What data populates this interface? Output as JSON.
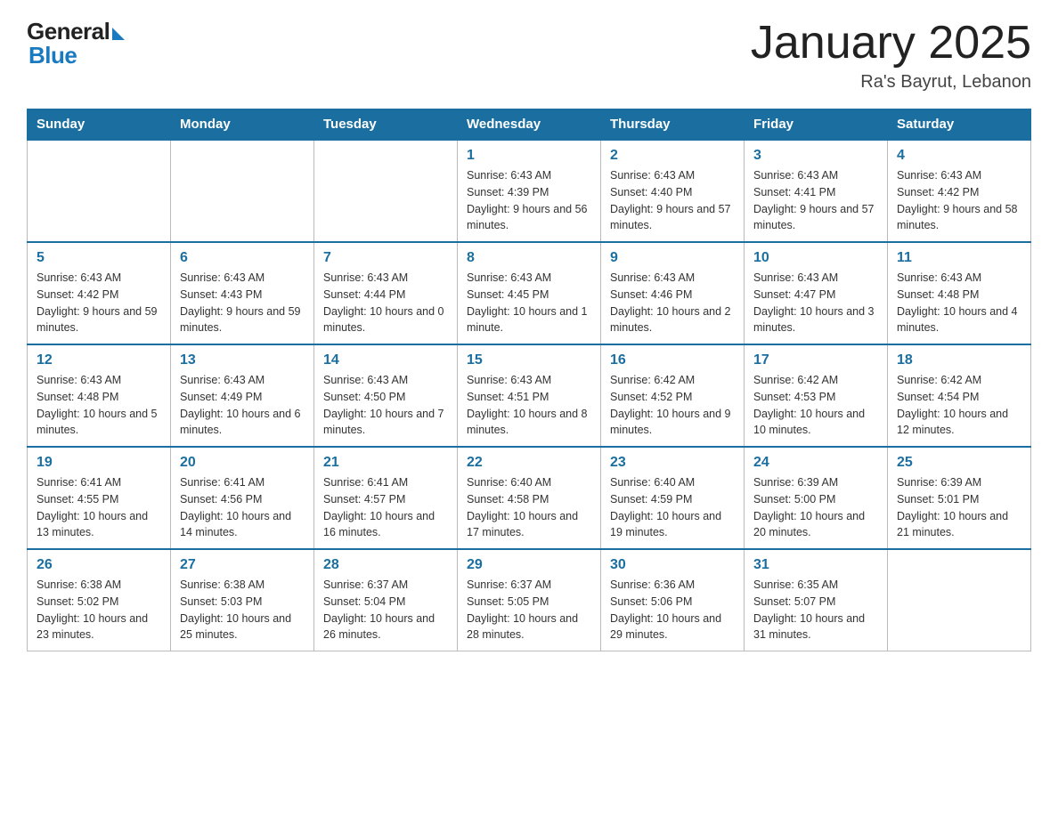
{
  "header": {
    "logo_general": "General",
    "logo_blue": "Blue",
    "month_title": "January 2025",
    "location": "Ra's Bayrut, Lebanon"
  },
  "weekdays": [
    "Sunday",
    "Monday",
    "Tuesday",
    "Wednesday",
    "Thursday",
    "Friday",
    "Saturday"
  ],
  "weeks": [
    [
      {
        "day": "",
        "info": ""
      },
      {
        "day": "",
        "info": ""
      },
      {
        "day": "",
        "info": ""
      },
      {
        "day": "1",
        "info": "Sunrise: 6:43 AM\nSunset: 4:39 PM\nDaylight: 9 hours and 56 minutes."
      },
      {
        "day": "2",
        "info": "Sunrise: 6:43 AM\nSunset: 4:40 PM\nDaylight: 9 hours and 57 minutes."
      },
      {
        "day": "3",
        "info": "Sunrise: 6:43 AM\nSunset: 4:41 PM\nDaylight: 9 hours and 57 minutes."
      },
      {
        "day": "4",
        "info": "Sunrise: 6:43 AM\nSunset: 4:42 PM\nDaylight: 9 hours and 58 minutes."
      }
    ],
    [
      {
        "day": "5",
        "info": "Sunrise: 6:43 AM\nSunset: 4:42 PM\nDaylight: 9 hours and 59 minutes."
      },
      {
        "day": "6",
        "info": "Sunrise: 6:43 AM\nSunset: 4:43 PM\nDaylight: 9 hours and 59 minutes."
      },
      {
        "day": "7",
        "info": "Sunrise: 6:43 AM\nSunset: 4:44 PM\nDaylight: 10 hours and 0 minutes."
      },
      {
        "day": "8",
        "info": "Sunrise: 6:43 AM\nSunset: 4:45 PM\nDaylight: 10 hours and 1 minute."
      },
      {
        "day": "9",
        "info": "Sunrise: 6:43 AM\nSunset: 4:46 PM\nDaylight: 10 hours and 2 minutes."
      },
      {
        "day": "10",
        "info": "Sunrise: 6:43 AM\nSunset: 4:47 PM\nDaylight: 10 hours and 3 minutes."
      },
      {
        "day": "11",
        "info": "Sunrise: 6:43 AM\nSunset: 4:48 PM\nDaylight: 10 hours and 4 minutes."
      }
    ],
    [
      {
        "day": "12",
        "info": "Sunrise: 6:43 AM\nSunset: 4:48 PM\nDaylight: 10 hours and 5 minutes."
      },
      {
        "day": "13",
        "info": "Sunrise: 6:43 AM\nSunset: 4:49 PM\nDaylight: 10 hours and 6 minutes."
      },
      {
        "day": "14",
        "info": "Sunrise: 6:43 AM\nSunset: 4:50 PM\nDaylight: 10 hours and 7 minutes."
      },
      {
        "day": "15",
        "info": "Sunrise: 6:43 AM\nSunset: 4:51 PM\nDaylight: 10 hours and 8 minutes."
      },
      {
        "day": "16",
        "info": "Sunrise: 6:42 AM\nSunset: 4:52 PM\nDaylight: 10 hours and 9 minutes."
      },
      {
        "day": "17",
        "info": "Sunrise: 6:42 AM\nSunset: 4:53 PM\nDaylight: 10 hours and 10 minutes."
      },
      {
        "day": "18",
        "info": "Sunrise: 6:42 AM\nSunset: 4:54 PM\nDaylight: 10 hours and 12 minutes."
      }
    ],
    [
      {
        "day": "19",
        "info": "Sunrise: 6:41 AM\nSunset: 4:55 PM\nDaylight: 10 hours and 13 minutes."
      },
      {
        "day": "20",
        "info": "Sunrise: 6:41 AM\nSunset: 4:56 PM\nDaylight: 10 hours and 14 minutes."
      },
      {
        "day": "21",
        "info": "Sunrise: 6:41 AM\nSunset: 4:57 PM\nDaylight: 10 hours and 16 minutes."
      },
      {
        "day": "22",
        "info": "Sunrise: 6:40 AM\nSunset: 4:58 PM\nDaylight: 10 hours and 17 minutes."
      },
      {
        "day": "23",
        "info": "Sunrise: 6:40 AM\nSunset: 4:59 PM\nDaylight: 10 hours and 19 minutes."
      },
      {
        "day": "24",
        "info": "Sunrise: 6:39 AM\nSunset: 5:00 PM\nDaylight: 10 hours and 20 minutes."
      },
      {
        "day": "25",
        "info": "Sunrise: 6:39 AM\nSunset: 5:01 PM\nDaylight: 10 hours and 21 minutes."
      }
    ],
    [
      {
        "day": "26",
        "info": "Sunrise: 6:38 AM\nSunset: 5:02 PM\nDaylight: 10 hours and 23 minutes."
      },
      {
        "day": "27",
        "info": "Sunrise: 6:38 AM\nSunset: 5:03 PM\nDaylight: 10 hours and 25 minutes."
      },
      {
        "day": "28",
        "info": "Sunrise: 6:37 AM\nSunset: 5:04 PM\nDaylight: 10 hours and 26 minutes."
      },
      {
        "day": "29",
        "info": "Sunrise: 6:37 AM\nSunset: 5:05 PM\nDaylight: 10 hours and 28 minutes."
      },
      {
        "day": "30",
        "info": "Sunrise: 6:36 AM\nSunset: 5:06 PM\nDaylight: 10 hours and 29 minutes."
      },
      {
        "day": "31",
        "info": "Sunrise: 6:35 AM\nSunset: 5:07 PM\nDaylight: 10 hours and 31 minutes."
      },
      {
        "day": "",
        "info": ""
      }
    ]
  ]
}
